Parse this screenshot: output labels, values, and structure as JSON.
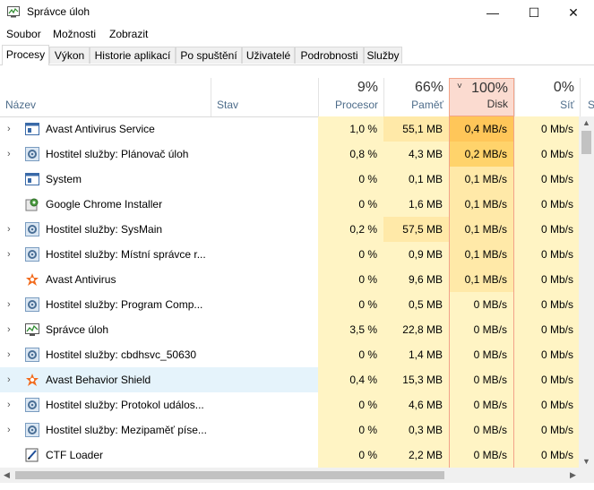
{
  "window": {
    "title": "Správce úloh",
    "minimize": "—",
    "maximize": "☐",
    "close": "✕"
  },
  "menu": [
    "Soubor",
    "Možnosti",
    "Zobrazit"
  ],
  "tabs": [
    "Procesy",
    "Výkon",
    "Historie aplikací",
    "Po spuštění",
    "Uživatelé",
    "Podrobnosti",
    "Služby"
  ],
  "columns": {
    "name": "Název",
    "status": "Stav",
    "cpu": {
      "pct": "9%",
      "label": "Procesor"
    },
    "mem": {
      "pct": "66%",
      "label": "Paměť"
    },
    "disk": {
      "pct": "100%",
      "label": "Disk"
    },
    "net": {
      "pct": "0%",
      "label": "Síť"
    },
    "extra": "S"
  },
  "colors": {
    "heat_light": "#fff4c4",
    "heat_mid": "#ffe9a8",
    "heat_high": "#ffd36b",
    "heat_top": "#ffc659",
    "disk_header": "#fbdbd0",
    "selected": "#e5f3fb"
  },
  "rows": [
    {
      "expand": true,
      "icon": "service-window-icon",
      "name": "Avast Antivirus  Service",
      "cpu": "1,0 %",
      "mem": "55,1 MB",
      "disk": "0,4 MB/s",
      "net": "0 Mb/s",
      "disk_heat": "top",
      "mem_heat": "mid"
    },
    {
      "expand": true,
      "icon": "gear-icon",
      "name": "Hostitel služby: Plánovač úloh",
      "cpu": "0,8 %",
      "mem": "4,3 MB",
      "disk": "0,2 MB/s",
      "net": "0 Mb/s",
      "disk_heat": "high",
      "mem_heat": "light"
    },
    {
      "expand": false,
      "icon": "service-window-icon",
      "name": "System",
      "cpu": "0 %",
      "mem": "0,1 MB",
      "disk": "0,1 MB/s",
      "net": "0 Mb/s",
      "disk_heat": "mid",
      "mem_heat": "light"
    },
    {
      "expand": false,
      "icon": "installer-icon",
      "name": "Google Chrome Installer",
      "cpu": "0 %",
      "mem": "1,6 MB",
      "disk": "0,1 MB/s",
      "net": "0 Mb/s",
      "disk_heat": "mid",
      "mem_heat": "light"
    },
    {
      "expand": true,
      "icon": "gear-icon",
      "name": "Hostitel služby: SysMain",
      "cpu": "0,2 %",
      "mem": "57,5 MB",
      "disk": "0,1 MB/s",
      "net": "0 Mb/s",
      "disk_heat": "mid",
      "mem_heat": "mid"
    },
    {
      "expand": true,
      "icon": "gear-icon",
      "name": "Hostitel služby: Místní správce r...",
      "cpu": "0 %",
      "mem": "0,9 MB",
      "disk": "0,1 MB/s",
      "net": "0 Mb/s",
      "disk_heat": "mid",
      "mem_heat": "light"
    },
    {
      "expand": false,
      "icon": "avast-icon",
      "name": "Avast Antivirus",
      "cpu": "0 %",
      "mem": "9,6 MB",
      "disk": "0,1 MB/s",
      "net": "0 Mb/s",
      "disk_heat": "mid",
      "mem_heat": "light"
    },
    {
      "expand": true,
      "icon": "gear-icon",
      "name": "Hostitel služby: Program Comp...",
      "cpu": "0 %",
      "mem": "0,5 MB",
      "disk": "0 MB/s",
      "net": "0 Mb/s",
      "disk_heat": "light",
      "mem_heat": "light"
    },
    {
      "expand": true,
      "icon": "task-manager-icon",
      "name": "Správce úloh",
      "cpu": "3,5 %",
      "mem": "22,8 MB",
      "disk": "0 MB/s",
      "net": "0 Mb/s",
      "disk_heat": "light",
      "mem_heat": "light"
    },
    {
      "expand": true,
      "icon": "gear-icon",
      "name": "Hostitel služby: cbdhsvc_50630",
      "cpu": "0 %",
      "mem": "1,4 MB",
      "disk": "0 MB/s",
      "net": "0 Mb/s",
      "disk_heat": "light",
      "mem_heat": "light"
    },
    {
      "expand": true,
      "icon": "avast-icon",
      "name": "Avast Behavior Shield",
      "cpu": "0,4 %",
      "mem": "15,3 MB",
      "disk": "0 MB/s",
      "net": "0 Mb/s",
      "disk_heat": "light",
      "mem_heat": "light",
      "selected": true
    },
    {
      "expand": true,
      "icon": "gear-icon",
      "name": "Hostitel služby: Protokol událos...",
      "cpu": "0 %",
      "mem": "4,6 MB",
      "disk": "0 MB/s",
      "net": "0 Mb/s",
      "disk_heat": "light",
      "mem_heat": "light"
    },
    {
      "expand": true,
      "icon": "gear-icon",
      "name": "Hostitel služby: Mezipaměť píse...",
      "cpu": "0 %",
      "mem": "0,3 MB",
      "disk": "0 MB/s",
      "net": "0 Mb/s",
      "disk_heat": "light",
      "mem_heat": "light"
    },
    {
      "expand": false,
      "icon": "ctf-loader-icon",
      "name": "CTF Loader",
      "cpu": "0 %",
      "mem": "2,2 MB",
      "disk": "0 MB/s",
      "net": "0 Mb/s",
      "disk_heat": "light",
      "mem_heat": "light"
    }
  ]
}
